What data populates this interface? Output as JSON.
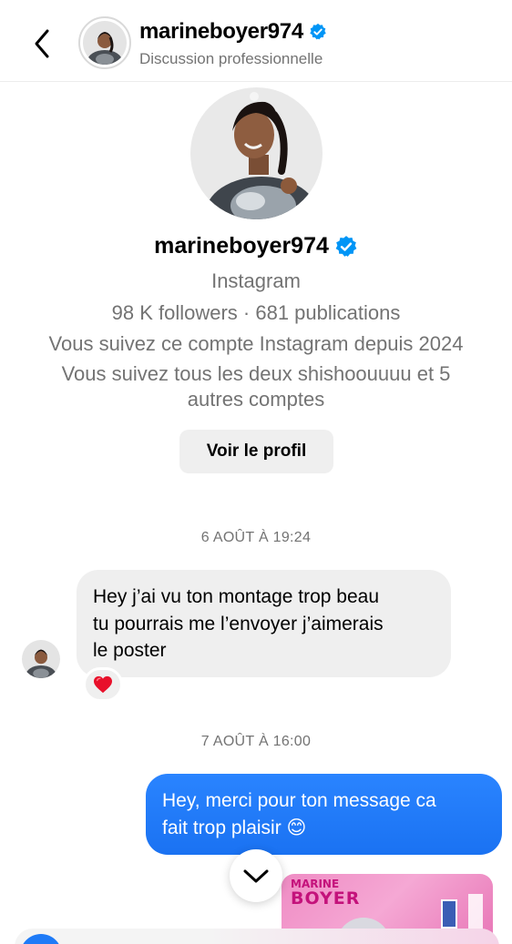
{
  "header": {
    "username": "marineboyer974",
    "subtitle": "Discussion professionnelle"
  },
  "profile": {
    "username": "marineboyer974",
    "platform": "Instagram",
    "stats": "98 K followers · 681 publications",
    "following_since": "Vous suivez ce compte Instagram depuis 2024",
    "mutuals_line1": "Vous suivez tous les deux shishoouuuu et 5",
    "mutuals_line2": "autres comptes",
    "view_profile_label": "Voir le profil"
  },
  "messages": [
    {
      "timestamp": "6 AOÛT À 19:24",
      "direction": "incoming",
      "lines": [
        "Hey j’ai vu ton montage trop beau",
        "tu pourrais me l’envoyer j’aimerais",
        "le poster"
      ],
      "reaction": "❤️"
    },
    {
      "timestamp": "7 AOÛT À 16:00",
      "direction": "outgoing",
      "lines": [
        "Hey, merci pour ton message ca",
        "fait trop plaisir 😊"
      ]
    }
  ],
  "shared_image": {
    "text_top": "MARINE",
    "text_name": "BOYER"
  },
  "colors": {
    "accent_blue": "#1f7bf7",
    "verified_blue": "#0095f6",
    "secondary_text": "#737373",
    "bubble_gray": "#efefef"
  },
  "icons": {
    "back": "chevron-left-icon",
    "verified": "verified-badge-icon",
    "scroll_down": "chevron-down-icon"
  }
}
